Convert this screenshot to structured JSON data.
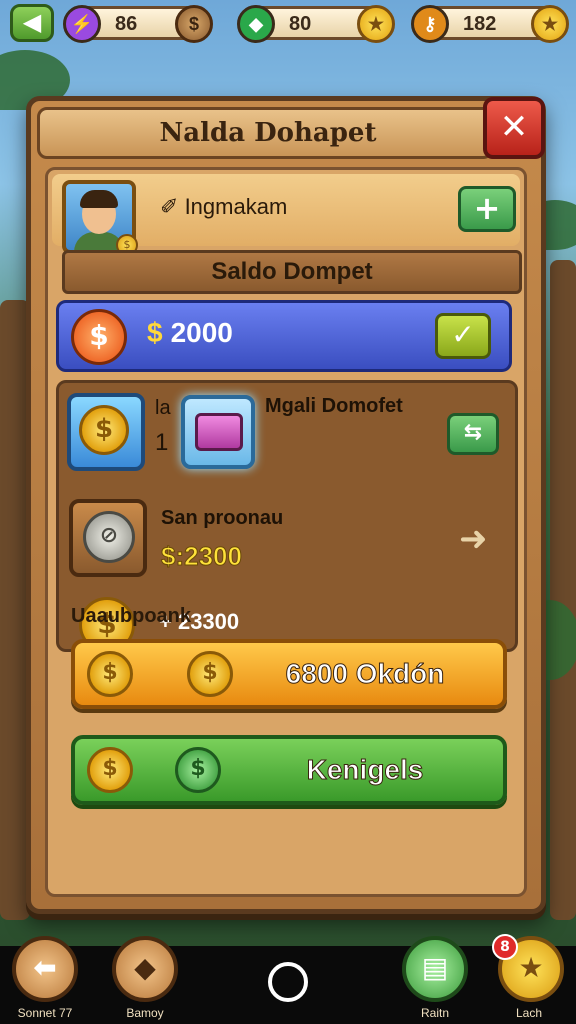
{
  "hud": {
    "back_icon": "arrow-left-icon",
    "currencies": [
      {
        "icon": "gem-icon",
        "value": "86",
        "color": "#9a4ae0"
      },
      {
        "icon": "emerald-icon",
        "value": "80",
        "color": "#2aa84a"
      },
      {
        "icon": "key-icon",
        "value": "182",
        "color": "#e08a1a"
      }
    ]
  },
  "dialog": {
    "title": "Nalda Dohapet",
    "close_icon": "close-icon",
    "profile": {
      "name": "Ingmakam",
      "add_icon": "plus-icon"
    },
    "section_title": "Saldo Dompet",
    "balance": {
      "currency_symbol": "$",
      "amount": "2000",
      "confirm_icon": "check-icon"
    },
    "items": [
      {
        "prefix_a": "la",
        "prefix_b": "1",
        "title": "Mgali Domofet",
        "action_icon": "swap-icon"
      },
      {
        "title": "San proonau",
        "value": "$:2300",
        "action_icon": "arrow-right-icon"
      },
      {
        "value": "+ 23300"
      }
    ],
    "subheader": "Uaaubpoank",
    "buttons": {
      "orange_label": "6800 Okdón",
      "green_label": "Kenigels"
    }
  },
  "bottom_nav": [
    {
      "label": "Sonnet 77",
      "icon": "back-arrow-icon"
    },
    {
      "label": "Bamoy",
      "icon": "diamond-icon"
    },
    {
      "label": "",
      "icon": "home-icon"
    },
    {
      "label": "Raitn",
      "icon": "cards-icon"
    },
    {
      "label": "Lach",
      "icon": "star-icon",
      "badge": "8"
    }
  ],
  "colors": {
    "panel": "#c58a4b",
    "balance_bar": "#4a5ed8",
    "orange_button": "#f2a52a",
    "green_button": "#4fb03a",
    "close_button": "#d6392d"
  }
}
